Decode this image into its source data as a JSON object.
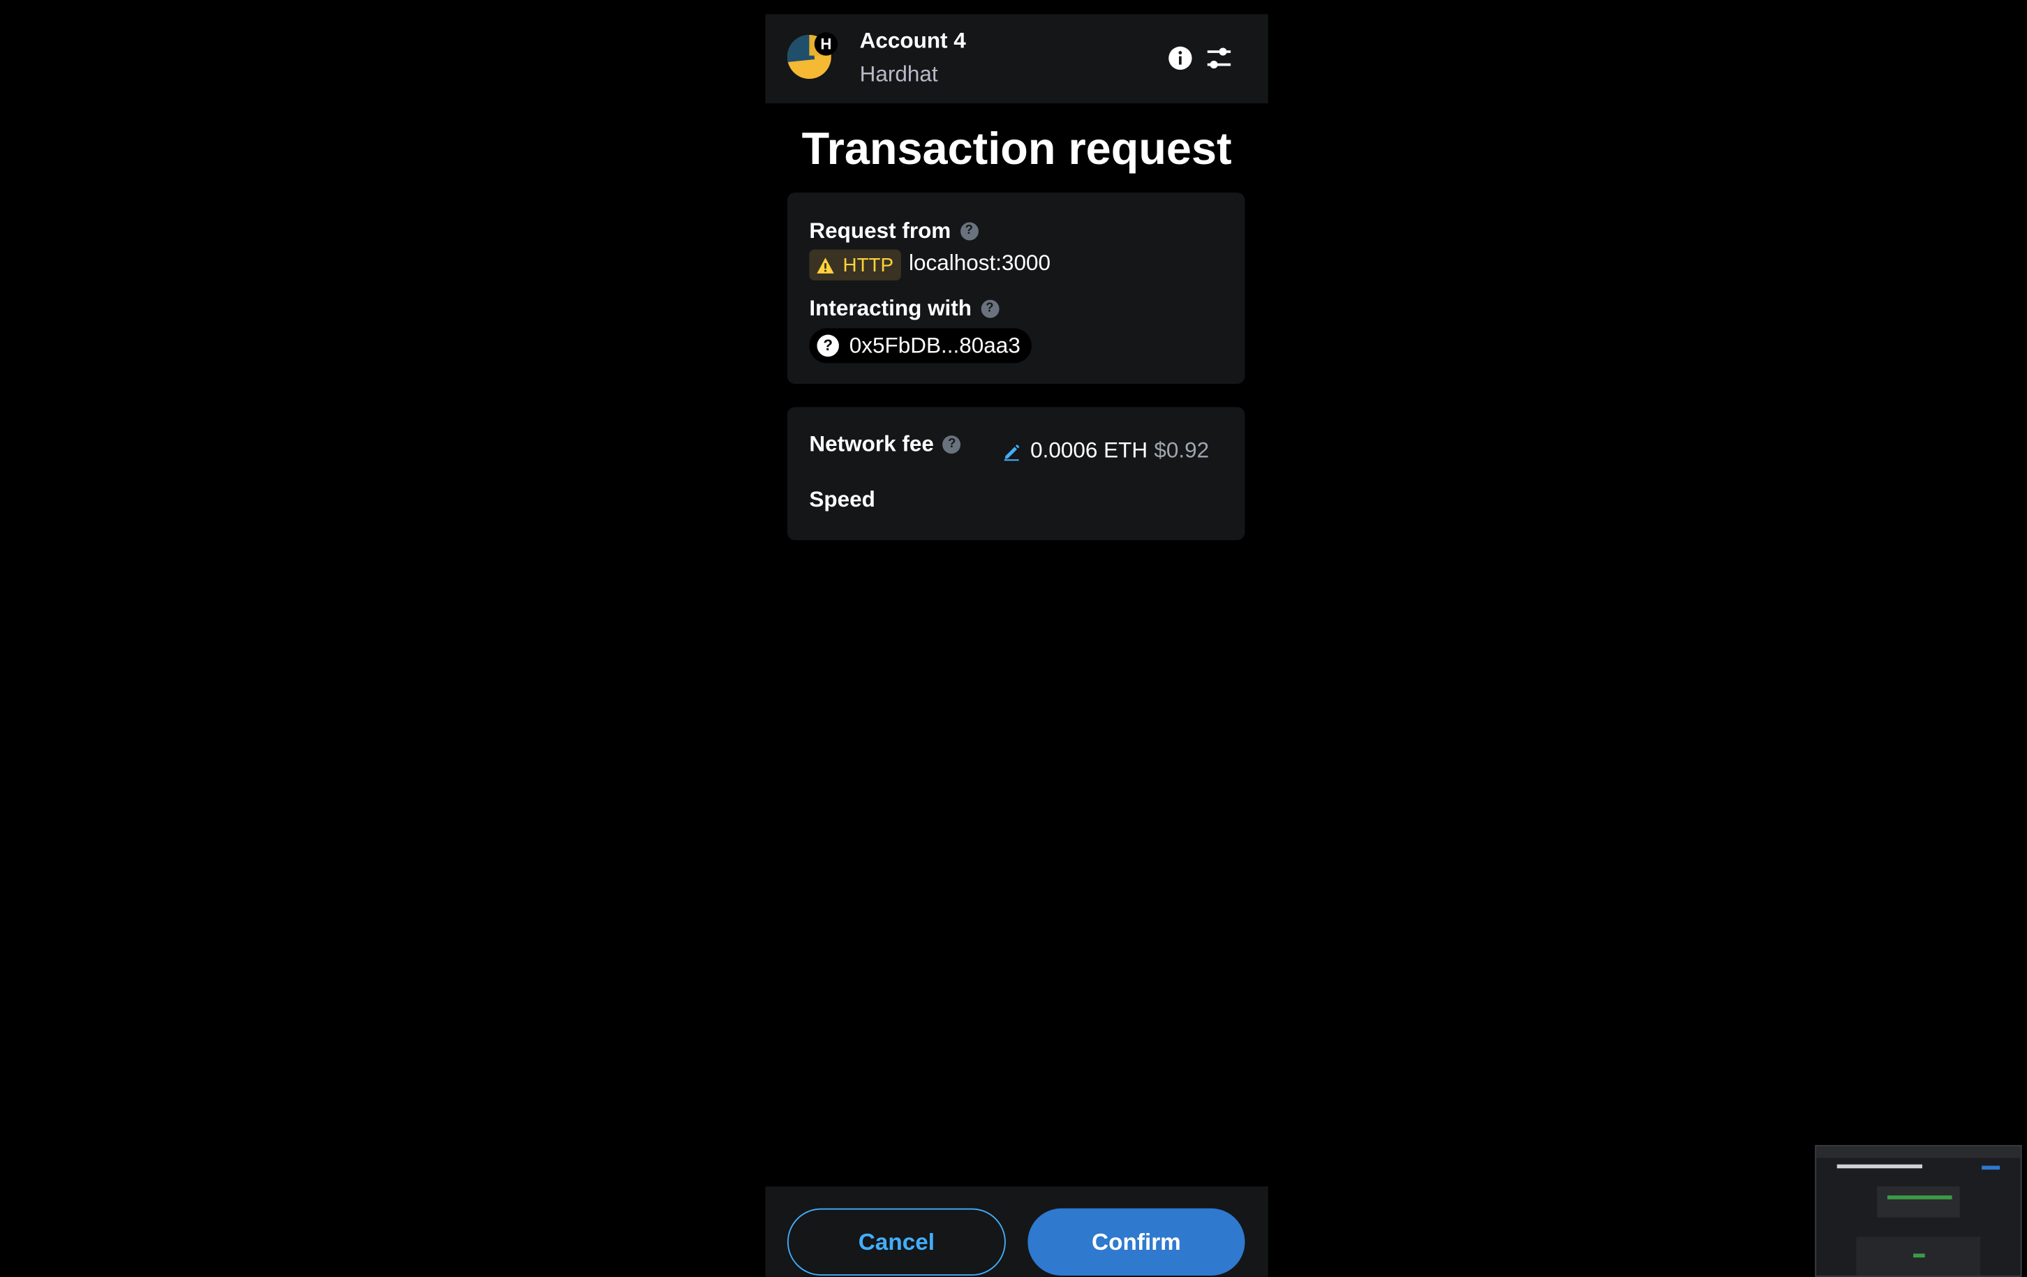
{
  "header": {
    "account_name": "Account 4",
    "network_name": "Hardhat",
    "network_initial": "H",
    "avatar_icon": "jazzicon-avatar",
    "info_icon": "info-icon",
    "settings_icon": "sliders-icon"
  },
  "title": "Transaction request",
  "request": {
    "from_label": "Request from",
    "protocol_badge": "HTTP",
    "origin": "localhost:3000",
    "interacting_label": "Interacting with",
    "contract_address": "0x5FbDB...80aa3",
    "address_icon_glyph": "?"
  },
  "fee": {
    "label": "Network fee",
    "eth_value": "0.0006 ETH",
    "fiat_value": "$0.92",
    "speed_label": "Speed",
    "edit_icon": "pencil-icon"
  },
  "footer": {
    "cancel_label": "Cancel",
    "confirm_label": "Confirm"
  },
  "colors": {
    "accent": "#43aefc",
    "confirm_bg": "#2f79cf",
    "card_bg": "#141618",
    "warning": "#ffd33d",
    "muted_text": "#b7bbc8"
  }
}
